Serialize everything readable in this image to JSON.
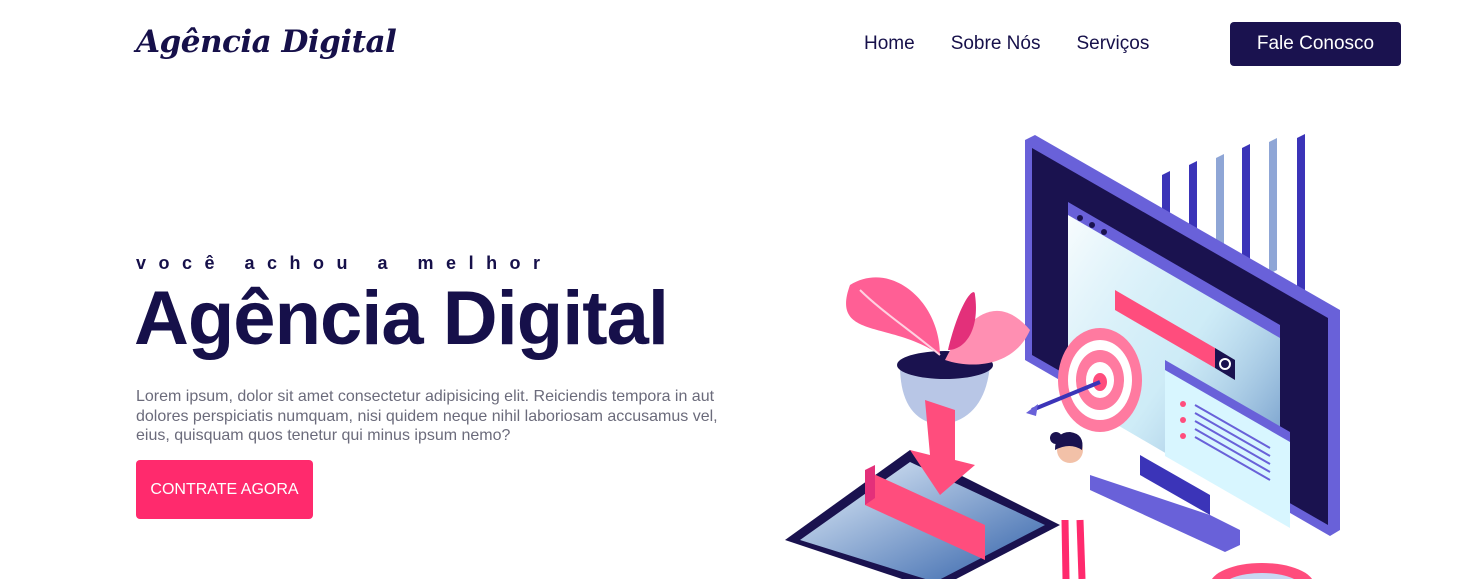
{
  "header": {
    "logo": "Agência Digital",
    "nav": [
      {
        "label": "Home"
      },
      {
        "label": "Sobre Nós"
      },
      {
        "label": "Serviços"
      }
    ],
    "cta_label": "Fale Conosco"
  },
  "hero": {
    "tagline": "você achou a melhor",
    "title": "Agência Digital",
    "description": "Lorem ipsum, dolor sit amet consectetur adipisicing elit. Reiciendis tempora in aut dolores perspiciatis numquam, nisi quidem neque nihil laboriosam accusamus vel, eius, quisquam quos tenetur qui minus ipsum nemo?",
    "cta_label": "CONTRATE AGORA"
  },
  "colors": {
    "navy": "#16104a",
    "accent_pink": "#ff2a6d",
    "button_dark": "#1a124f",
    "text_gray": "#6b6b7b"
  },
  "illustration": {
    "icons": [
      "monitor-icon",
      "target-icon",
      "plant-icon",
      "tablet-icon",
      "person-icon",
      "search-icon"
    ]
  }
}
